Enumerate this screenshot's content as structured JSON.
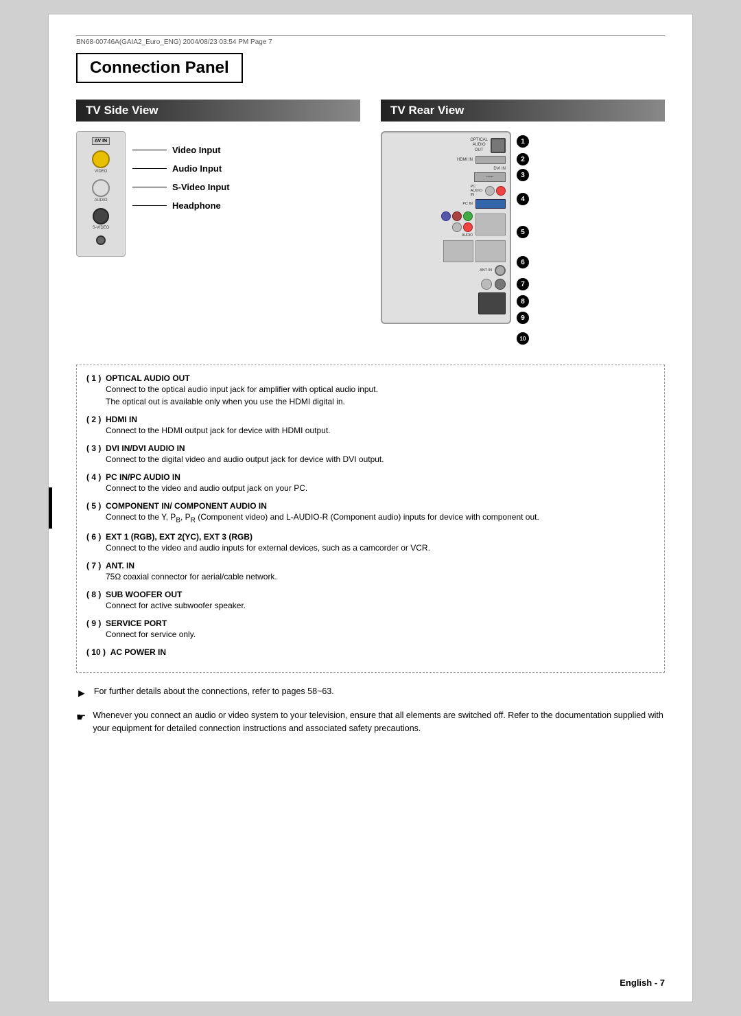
{
  "fileHeader": "BN68-00746A(GAIA2_Euro_ENG)   2004/08/23   03:54 PM   Page  7",
  "pageTitle": "Connection Panel",
  "tvSideView": {
    "title": "TV Side View",
    "deviceLabel": "AV IN",
    "connectors": [
      {
        "label": "VIDEO",
        "type": "yellow"
      },
      {
        "label": "AUDIO",
        "type": "white"
      },
      {
        "label": "S-VIDEO",
        "type": "svideo"
      },
      {
        "label": "♡",
        "type": "headphone"
      }
    ],
    "labels": [
      "Video Input",
      "Audio Input",
      "S-Video Input",
      "Headphone"
    ]
  },
  "tvRearView": {
    "title": "TV Rear View",
    "sections": [
      {
        "num": "1",
        "portLabel": "OPTICAL\nAUDIO\nOUT"
      },
      {
        "num": "2",
        "portLabel": "HDMI IN"
      },
      {
        "num": "3",
        "portLabel": "DVI IN"
      },
      {
        "num": "4",
        "portLabel": "PC IN"
      },
      {
        "num": "5",
        "portLabel": "COMPONENT\nIN"
      },
      {
        "num": "6",
        "portLabel": "EXT 1/2/3"
      },
      {
        "num": "7",
        "portLabel": "ANT. IN"
      },
      {
        "num": "8",
        "portLabel": "SUB\nWOOFER\nOUT"
      },
      {
        "num": "9",
        "portLabel": "SERVICE\nPORT"
      },
      {
        "num": "10",
        "portLabel": "AC POWER\nIN"
      }
    ]
  },
  "descriptions": [
    {
      "num": "1",
      "title": "OPTICAL AUDIO OUT",
      "text": "Connect to the optical audio input jack for amplifier with optical audio input.\nThe optical out is available only when you use the HDMI digital in."
    },
    {
      "num": "2",
      "title": "HDMI IN",
      "text": "Connect to the HDMI output jack for device with HDMI output."
    },
    {
      "num": "3",
      "title": "DVI IN/DVI AUDIO IN",
      "text": "Connect to the digital video and audio output jack for device with DVI output."
    },
    {
      "num": "4",
      "title": "PC IN/PC AUDIO IN",
      "text": "Connect to the video and audio output jack on your PC."
    },
    {
      "num": "5",
      "title": "COMPONENT IN/ COMPONENT AUDIO IN",
      "text": "Connect to the Y, PB, PR (Component video) and L-AUDIO-R (Component audio) inputs for device with component out."
    },
    {
      "num": "6",
      "title": "EXT 1 (RGB),  EXT 2(YC),  EXT 3 (RGB)",
      "text": "Connect to the video and audio inputs for external devices, such as a camcorder or VCR."
    },
    {
      "num": "7",
      "title": "ANT. IN",
      "text": "75Ω coaxial connector for aerial/cable network."
    },
    {
      "num": "8",
      "title": "SUB WOOFER OUT",
      "text": "Connect for active subwoofer speaker."
    },
    {
      "num": "9",
      "title": "SERVICE PORT",
      "text": "Connect for service only."
    },
    {
      "num": "10",
      "title": "AC POWER IN",
      "text": ""
    }
  ],
  "notes": [
    {
      "type": "arrow",
      "text": "For further details about the connections, refer to pages 58~63."
    },
    {
      "type": "hand",
      "text": "Whenever you connect an audio or video system to your television, ensure that all elements are switched off. Refer to the documentation supplied with your equipment  for detailed connection instructions and associated safety precautions."
    }
  ],
  "footer": {
    "text": "English - 7"
  }
}
